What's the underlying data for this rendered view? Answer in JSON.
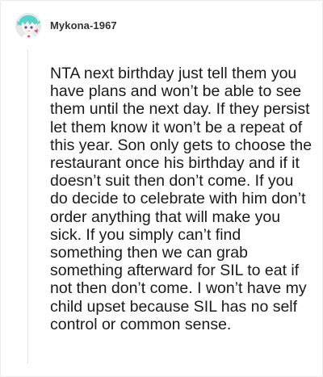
{
  "comment": {
    "username": "Mykona-1967",
    "avatar_icon": "anime-character-avatar-icon",
    "text": "NTA next birthday just tell them you have plans and won’t be able to see them until the next day. If they persist let them know it won’t be a repeat of this year. Son only gets to choose the restaurant once his birthday and if it doesn’t suit then don’t come. If you do decide to celebrate with him don’t order anything that will make you sick. If you simply can’t find something then we can grab something afterward for SIL to eat if not then don’t come. I won’t have my child upset because SIL has no self control or common sense."
  },
  "colors": {
    "avatar_hair": "#5ad1c9",
    "avatar_bg": "#e6e6e6",
    "text": "#1a1a1a",
    "username": "#333333"
  }
}
